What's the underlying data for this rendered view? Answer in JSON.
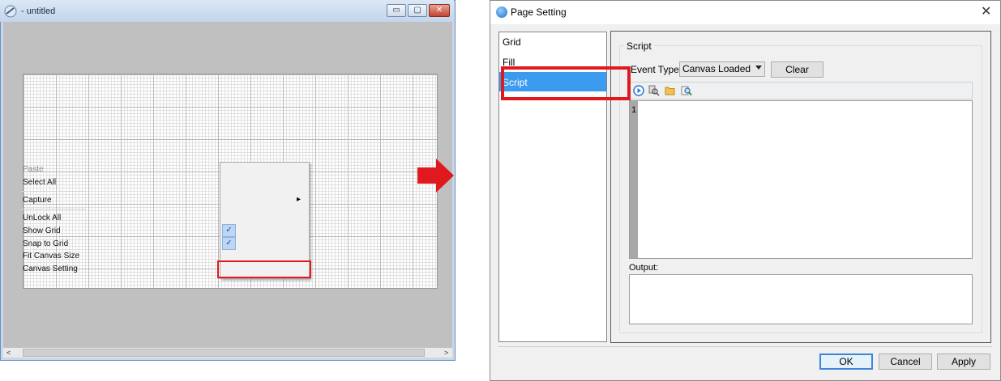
{
  "left_window": {
    "title": "- untitled",
    "controls": {
      "minimize": "▭",
      "maximize": "▢",
      "close": "✕"
    },
    "scroll_left": "<",
    "scroll_right": ">"
  },
  "context_menu": {
    "items": [
      {
        "label": "Paste",
        "enabled": false
      },
      {
        "label": "Select All",
        "enabled": true
      },
      {
        "label": "Capture",
        "enabled": true,
        "submenu": true
      },
      {
        "label": "UnLock All",
        "enabled": true
      },
      {
        "label": "Show Grid",
        "enabled": true,
        "checked": true
      },
      {
        "label": "Snap to Grid",
        "enabled": true,
        "checked": true
      },
      {
        "label": "Fit Canvas Size",
        "enabled": true
      },
      {
        "label": "Canvas Setting",
        "enabled": true,
        "highlighted": true
      }
    ],
    "submenu_arrow": "▸",
    "check_mark": "✓"
  },
  "arrow_color": "#e0191f",
  "dialog": {
    "title": "Page Setting",
    "close": "✕",
    "nav": {
      "items": [
        "Grid",
        "Fill",
        "Script"
      ],
      "selected": "Script"
    },
    "script_group": {
      "title": "Script",
      "event_type_label": "Event Type :",
      "event_type_value": "Canvas Loaded",
      "clear_label": "Clear",
      "toolbar_icons": [
        "run-icon",
        "find-icon",
        "open-folder-icon",
        "zoom-icon"
      ],
      "line_number": "1",
      "output_label": "Output:"
    },
    "buttons": {
      "ok": "OK",
      "cancel": "Cancel",
      "apply": "Apply"
    },
    "accent": "#3b9bee"
  }
}
